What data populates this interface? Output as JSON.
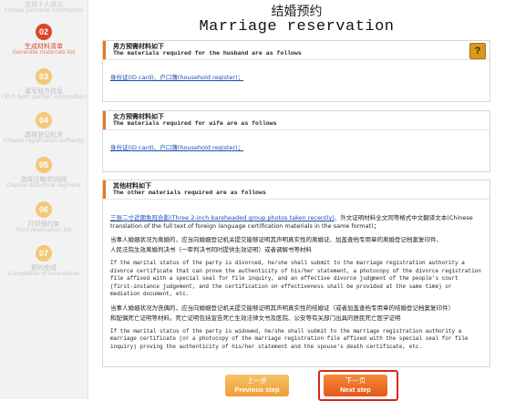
{
  "steps": [
    {
      "num": "01",
      "cn": "选择个人情况",
      "en": "Choose personal information",
      "state": "done"
    },
    {
      "num": "02",
      "cn": "生成材料清单",
      "en": "Generate materials list",
      "state": "active"
    },
    {
      "num": "03",
      "cn": "填写双方信息",
      "en": "Fill in both parties' information",
      "state": "todo"
    },
    {
      "num": "04",
      "cn": "选择登记机关",
      "en": "Choose registration authority",
      "state": "todo"
    },
    {
      "num": "05",
      "cn": "选择日期/时间段",
      "en": "Choose date/time segment",
      "state": "todo"
    },
    {
      "num": "06",
      "cn": "打印预约单",
      "en": "Print reservation list",
      "state": "todo"
    },
    {
      "num": "07",
      "cn": "预约完成",
      "en": "Completion of reservation",
      "state": "todo"
    }
  ],
  "header": {
    "title_cn": "结婚预约",
    "title_en": "Marriage reservation"
  },
  "husband": {
    "title_cn": "男方预需材料如下",
    "title_en": "The materials required for the husband are as follows",
    "help": "?",
    "items": "身份证(ID card)、户口簿(household register)；"
  },
  "wife": {
    "title_cn": "女方预需材料如下",
    "title_en": "The materials required for wife are as follows",
    "items": "身份证(ID card)、户口簿(household register)；"
  },
  "other": {
    "title_cn": "其他材料如下",
    "title_en": "The other materials required are as follows",
    "photo_link": "三张二寸近期免冠合影(Three 2-inch bareheaded group photos taken recently)",
    "photo_rest": "、外文证明材料全文同等格式中文翻译文本(Chinese translation of the full text of foreign language certification materials in the same format)；",
    "divorce_cn_1": "当事人婚姻状况为离婚的，应当向婚姻登记机关提交能够证明其声明真实性的离婚证、加盖查档专用章的离婚登记档案复印件、",
    "divorce_cn_2": "人民法院生效离婚判决书（一审判决书同时提供生效证明）或者调解书等材料",
    "divorce_en": "If the marital status of the party is divorced, he/she shall submit to the marriage registration authority a divorce certificate that can prove the authenticity of his/her statement, a photocopy of the divorce registration file affixed with a special seal for file inquiry, and an effective divorce judgment of the people's court (first-instance judgement, and the certification on effectiveness shall be provided at the same time) or mediation document, etc.",
    "widow_cn_1": "当事人婚姻状况为丧偶的，应当向婚姻登记机关提交能够证明其声明真实性的结婚证（或者加盖查档专用章的结婚登记档案复印件）",
    "widow_cn_2": "和配偶死亡证明等材料。死亡证明包括宣告死亡生效法律文书及医院、公安等有关部门出具的居民死亡医学证明",
    "widow_en": "If the marital status of the party is widowed, he/she shall submit to the marriage registration authority a marriage certificate (or a photocopy of the marriage registration file affixed with the special seal for file inquiry) proving the authenticity of his/her statement and the spouse's death certificate, etc."
  },
  "buttons": {
    "prev_cn": "上一步",
    "prev_en": "Previous step",
    "next_cn": "下一页",
    "next_en": "Next step"
  },
  "colors": {
    "accent": "#e8761f",
    "active_step": "#d9472b",
    "link": "#1a4fb0"
  }
}
